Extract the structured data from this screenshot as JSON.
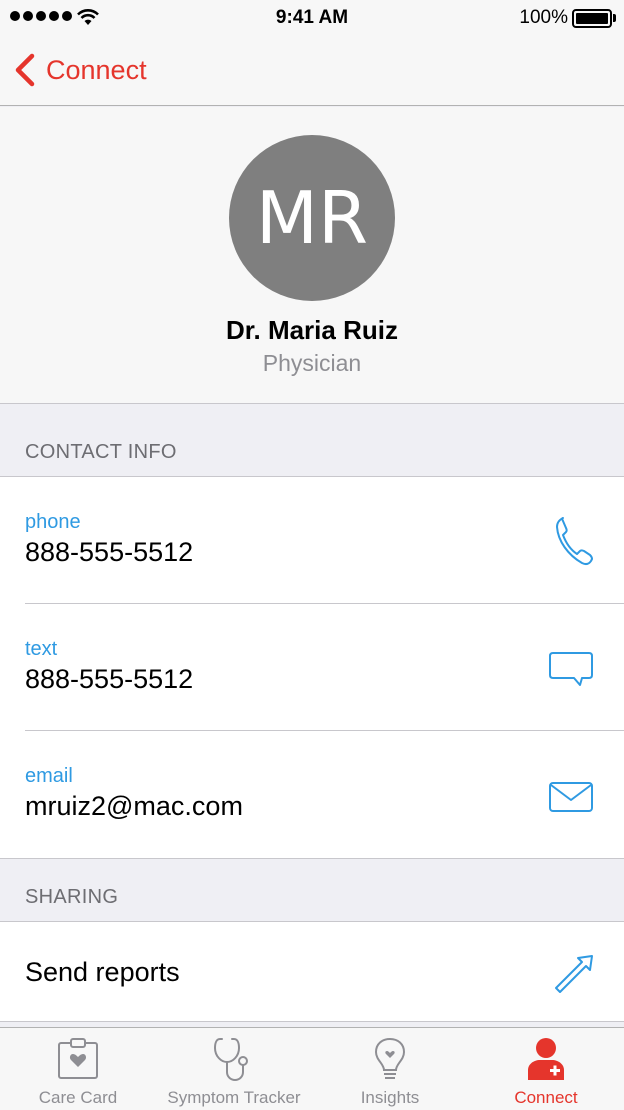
{
  "status_bar": {
    "time": "9:41 AM",
    "battery": "100%"
  },
  "nav": {
    "back_label": "Connect"
  },
  "profile": {
    "initials": "MR",
    "name": "Dr. Maria Ruiz",
    "role": "Physician"
  },
  "sections": {
    "contact_info": "CONTACT INFO",
    "sharing": "SHARING"
  },
  "contact_rows": [
    {
      "label": "phone",
      "value": "888-555-5512",
      "icon": "phone-icon"
    },
    {
      "label": "text",
      "value": "888-555-5512",
      "icon": "message-icon"
    },
    {
      "label": "email",
      "value": "mruiz2@mac.com",
      "icon": "mail-icon"
    }
  ],
  "sharing_row": {
    "label": "Send reports",
    "icon": "send-arrow-icon"
  },
  "tabs": [
    {
      "label": "Care Card",
      "icon": "care-card-icon",
      "active": false
    },
    {
      "label": "Symptom Tracker",
      "icon": "stethoscope-icon",
      "active": false
    },
    {
      "label": "Insights",
      "icon": "lightbulb-icon",
      "active": false
    },
    {
      "label": "Connect",
      "icon": "connect-person-icon",
      "active": true
    }
  ],
  "colors": {
    "accent": "#e5352c",
    "link": "#2f9ae2",
    "avatar": "#7f7f7f"
  }
}
